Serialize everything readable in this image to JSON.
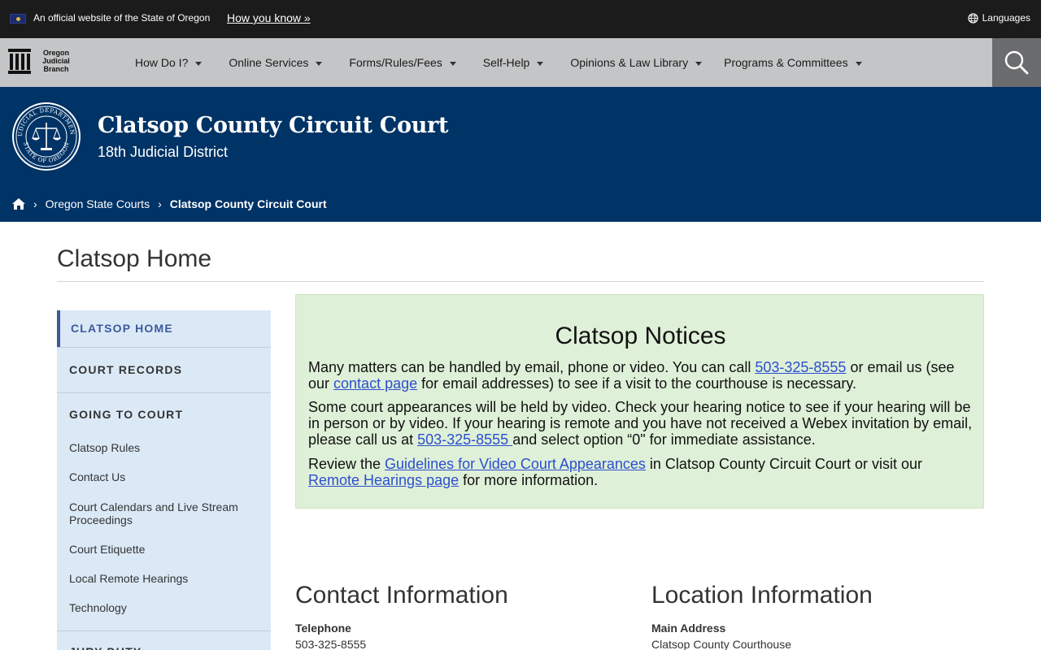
{
  "official_bar": {
    "text": "An official website of the State of Oregon",
    "how_link": "How you know »",
    "languages": "Languages"
  },
  "logo": {
    "line1": "Oregon",
    "line2": "Judicial",
    "line3": "Branch"
  },
  "nav": {
    "items": [
      {
        "label": "How Do I?"
      },
      {
        "label": "Online Services"
      },
      {
        "label": "Forms/Rules/Fees"
      },
      {
        "label": "Self-Help"
      },
      {
        "label": "Opinions & Law Library"
      },
      {
        "label": "Programs & Committees"
      }
    ]
  },
  "hero": {
    "title": "Clatsop County Circuit Court",
    "subtitle": "18th Judicial District",
    "seal_top": "JUDICIAL DEPARTMENT",
    "seal_bottom": "STATE OF OREGON"
  },
  "breadcrumb": {
    "items": [
      "Oregon State Courts",
      "Clatsop County Circuit Court"
    ]
  },
  "page": {
    "title": "Clatsop Home"
  },
  "sidebar": {
    "active": "CLATSOP HOME",
    "records": "COURT RECORDS",
    "going": "GOING TO COURT",
    "links": [
      "Clatsop Rules",
      "Contact Us",
      "Court Calendars and Live Stream Proceedings",
      "Court Etiquette",
      "Local Remote Hearings",
      "Technology"
    ],
    "jury": "JURY DUTY"
  },
  "notice": {
    "title": "Clatsop Notices",
    "p1_a": "Many matters can be handled by email, phone or video.  You can call ",
    "p1_phone": "503-325-8555",
    "p1_b": " or email us (see our ",
    "p1_link": "contact page",
    "p1_c": " for email addresses) to see if a visit to the courthouse is necessary.",
    "p2_a": "Some court appearances will be held by video. Check your hearing notice to see if your hearing will be in person or by video. If your hearing is remote and you have not received a Webex invitation by email, please call us at ",
    "p2_phone": "503-325-8555 ",
    "p2_b": "and select option “0\" for immediate assistance.",
    "p3_a": "Review the ",
    "p3_link1": "Guidelines for Video Court Appearances",
    "p3_b": " in Clatsop County Circuit Court or visit our ",
    "p3_link2": "Remote Hearings page",
    "p3_c": " for more information."
  },
  "contact": {
    "heading": "Contact Information",
    "label": "Telephone",
    "value": "503-325-8555"
  },
  "location": {
    "heading": "Location Information",
    "label": "Main Address",
    "value": "Clatsop County Courthouse"
  },
  "colors": {
    "hero_bg": "#003366",
    "nav_bg": "#c4c5c6",
    "sidebar_bg": "#dbe9f7",
    "notice_bg": "#dff0d8",
    "link": "#2b4fcf"
  }
}
